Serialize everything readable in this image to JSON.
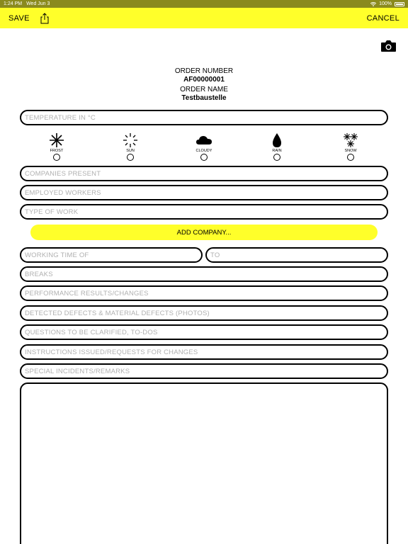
{
  "status_bar": {
    "time": "1:24 PM",
    "date": "Wed Jun 3",
    "battery": "100%"
  },
  "toolbar": {
    "save_label": "SAVE",
    "cancel_label": "CANCEL"
  },
  "order": {
    "number_label": "ORDER NUMBER",
    "number_value": "AF00000001",
    "name_label": "ORDER NAME",
    "name_value": "Testbaustelle"
  },
  "fields": {
    "temperature": "TEMPERATURE IN °C",
    "companies_present": "COMPANIES PRESENT",
    "employed_workers": "EMPLOYED WORKERS",
    "type_of_work": "TYPE OF WORK",
    "working_time_of": "WORKING TIME OF",
    "to": "TO",
    "breaks": "BREAKS",
    "performance": "PERFORMANCE RESULTS/CHANGES",
    "defects": "DETECTED DEFECTS & MATERIAL DEFECTS (PHOTOS)",
    "questions": "QUESTIONS TO BE CLARIFIED, TO-DOS",
    "instructions": "INSTRUCTIONS ISSUED/REQUESTS FOR CHANGES",
    "special": "SPECIAL INCIDENTS/REMARKS"
  },
  "weather": {
    "options": [
      {
        "label": "FROST",
        "icon": "frost-icon"
      },
      {
        "label": "SUN",
        "icon": "sun-icon"
      },
      {
        "label": "CLOUDY",
        "icon": "cloud-icon"
      },
      {
        "label": "RAIN",
        "icon": "rain-drop-icon"
      },
      {
        "label": "SNOW",
        "icon": "snowflakes-icon"
      }
    ]
  },
  "add_company_label": "ADD COMPANY...",
  "colors": {
    "accent": "#ffff2a",
    "status_bar": "#8a8a1e",
    "placeholder": "#b0b0b0"
  }
}
